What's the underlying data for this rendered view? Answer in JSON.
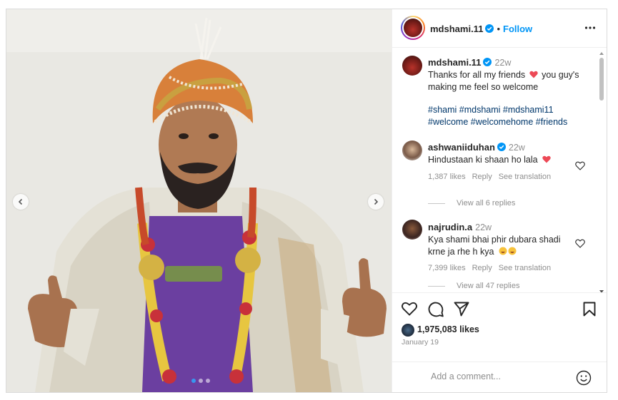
{
  "post": {
    "author": "mdshami.11",
    "follow_label": "Follow",
    "separator": "•",
    "caption_time": "22w",
    "caption_text": "Thanks for all my friends ❤️ you guy's making me feel so welcome",
    "caption_line1": "Thanks for all my friends",
    "caption_line1b": "you guy's",
    "caption_line2": "making me feel so welcome",
    "hashtags_line1": "#shami #mdshami #mdshami11",
    "hashtags_line2": "#welcome #welcomehome #friends",
    "likes": "1,975,083 likes",
    "date": "January 19"
  },
  "comments": [
    {
      "user": "ashwaniiduhan",
      "time": "22w",
      "text": "Hindustaan ki shaan ho lala",
      "likes": "1,387 likes",
      "reply_label": "Reply",
      "translate_label": "See translation",
      "view_replies": "View all 6 replies"
    },
    {
      "user": "najrudin.a",
      "time": "22w",
      "text_line1": "Kya shami bhai phir dubara shadi",
      "text_line2": "krne ja rhe h kya",
      "likes": "7,399 likes",
      "reply_label": "Reply",
      "translate_label": "See translation",
      "view_replies": "View all 47 replies"
    }
  ],
  "add_comment": {
    "placeholder": "Add a comment..."
  },
  "icons": {
    "like": "heart-icon",
    "comment": "comment-icon",
    "share": "send-icon",
    "save": "bookmark-icon",
    "more": "more-dots-icon",
    "emoji": "emoji-icon",
    "verified": "verified-badge-icon",
    "prev": "chevron-left-icon",
    "next": "chevron-right-icon"
  },
  "colors": {
    "accent": "#0095f6",
    "verified": "#0095f6",
    "heart_red": "#ed4956"
  },
  "carousel": {
    "slide_count": 3,
    "active_index": 1
  }
}
